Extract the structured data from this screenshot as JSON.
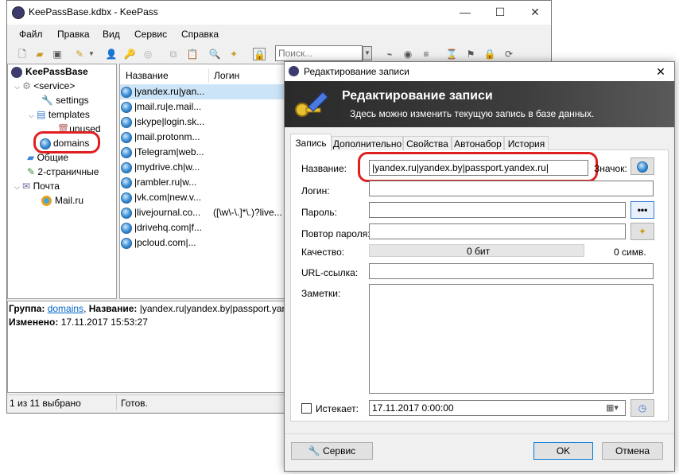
{
  "main_window": {
    "title": "KeePassBase.kdbx - KeePass",
    "menu": [
      "Файл",
      "Правка",
      "Вид",
      "Сервис",
      "Справка"
    ],
    "search_placeholder": "Поиск...",
    "tree": {
      "root": "KeePassBase",
      "items": [
        "<service>",
        "settings",
        "templates",
        "unused",
        "domains",
        "Общие",
        "2-страничные",
        "Почта",
        "Mail.ru"
      ]
    },
    "columns": [
      "Название",
      "Логин"
    ],
    "entries": [
      {
        "title": "|yandex.ru|yan...",
        "login": ""
      },
      {
        "title": "|mail.ru|e.mail...",
        "login": ""
      },
      {
        "title": "|skype|login.sk...",
        "login": ""
      },
      {
        "title": "|mail.protonm...",
        "login": ""
      },
      {
        "title": "|Telegram|web...",
        "login": ""
      },
      {
        "title": "|mydrive.ch|w...",
        "login": ""
      },
      {
        "title": "|rambler.ru|w...",
        "login": ""
      },
      {
        "title": "|vk.com|new.v...",
        "login": ""
      },
      {
        "title": "|livejournal.co...",
        "login": "([\\w\\-\\.]*\\.)?live..."
      },
      {
        "title": "|drivehq.com|f...",
        "login": ""
      },
      {
        "title": "|pcloud.com|...",
        "login": ""
      }
    ],
    "info": {
      "group_label": "Группа:",
      "group_value": "domains",
      "name_label": "Название:",
      "name_value": "|yandex.ru|yandex.by|passport.yand",
      "changed_label": "Изменено:",
      "changed_value": "17.11.2017 15:53:27"
    },
    "status": {
      "selection": "1 из 11 выбрано",
      "state": "Готов."
    }
  },
  "dialog": {
    "title": "Редактирование записи",
    "banner_title": "Редактирование записи",
    "banner_subtitle": "Здесь можно изменить текущую запись в базе данных.",
    "tabs": [
      "Запись",
      "Дополнительно",
      "Свойства",
      "Автонабор",
      "История"
    ],
    "labels": {
      "name": "Название:",
      "icon": "Значок:",
      "login": "Логин:",
      "password": "Пароль:",
      "repeat": "Повтор пароля:",
      "quality": "Качество:",
      "url": "URL-ссылка:",
      "notes": "Заметки:",
      "expires": "Истекает:"
    },
    "values": {
      "name": "|yandex.ru|yandex.by|passport.yandex.ru|",
      "login": "",
      "password": "",
      "repeat": "",
      "url": "",
      "notes": "",
      "quality_bits": "0 бит",
      "quality_chars": "0 симв.",
      "expires": "17.11.2017   0:00:00"
    },
    "password_toggle": "•••",
    "buttons": {
      "tools": "Сервис",
      "ok": "OK",
      "cancel": "Отмена"
    }
  },
  "colors": {
    "highlight_red": "#e02020",
    "banner_bg": "#3a3a3a",
    "selection_bg": "#cce4f7"
  }
}
